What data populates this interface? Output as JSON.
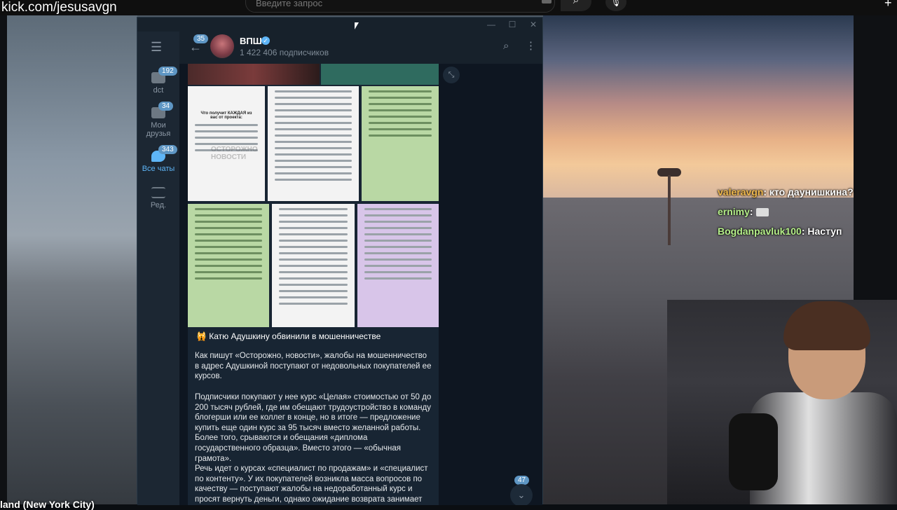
{
  "overlay": {
    "url": "kick.com/jesusavgn",
    "bottom_text": "land (New York City)"
  },
  "browser": {
    "search_placeholder": "Введите запрос"
  },
  "window": {
    "minimize": "—",
    "maximize": "☐",
    "close": "✕"
  },
  "sidebar": {
    "menu_icon": "☰",
    "folders": [
      {
        "label": "dct",
        "badge": "192"
      },
      {
        "label": "Мои друзья",
        "badge": "34"
      },
      {
        "label": "Все чаты",
        "badge": "343"
      },
      {
        "label": "Ред.",
        "badge": ""
      }
    ]
  },
  "channel": {
    "unread": "35",
    "name": "ВПШ",
    "subscribers": "1 422 406 подписчиков"
  },
  "post": {
    "title": "Катю Адушкину обвинили в мошенничестве",
    "paragraphs": [
      "Как пишут «Осторожно, новости», жалобы на мошенничество в адрес Адушкиной поступают от недовольных покупателей ее курсов.",
      "Подписчики покупают у нее курс «Целая» стоимостью от 50 до 200 тысяч рублей, где им обещают трудоустройство в команду блогерши или ее коллег в конце, но в итоге — предложение купить еще один курс за 95 тысяч вместо желанной работы. Более того, срываются и обещания «диплома государственного образца». Вместо этого — «обычная грамота».",
      "Речь идет о курсах «специалист по продажам» и «специалист по контенту». У их покупателей возникла масса вопросов по качеству — поступают жалобы на недоработанный курс и просят вернуть деньги, однако ожидание возврата занимает"
    ],
    "photo_watermark": "ОСТОРОЖНО НОВОСТИ",
    "photo1_heading": "Что получит КАЖДАЯ из вас от проекта:"
  },
  "chat_area": {
    "scroll_badge": "47"
  },
  "stream_chat": [
    {
      "nick": "valeravgn",
      "text": ": кто даунишкина?"
    },
    {
      "nick": "ernimy",
      "text": ":"
    },
    {
      "nick": "Bogdanpavluk100",
      "text": ": Наступ"
    }
  ],
  "colors": {
    "telegram_bg": "#17212b",
    "accent": "#5eb5f7",
    "badge": "#5e96c4"
  }
}
